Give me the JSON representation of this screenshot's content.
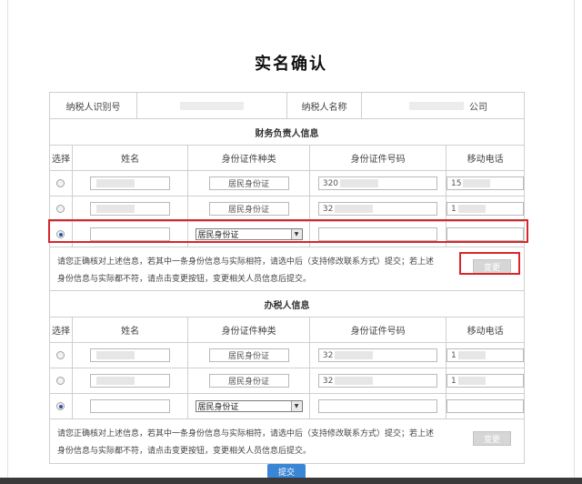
{
  "title": "实名确认",
  "taxpayer": {
    "id_label": "纳税人识别号",
    "name_label": "纳税人名称",
    "name_suffix": "公司"
  },
  "finance_section": {
    "title": "财务负责人信息",
    "headers": [
      "选择",
      "姓名",
      "身份证件种类",
      "身份证件号码",
      "移动电话"
    ],
    "rows": [
      {
        "selected": false,
        "name": "",
        "id_type": "居民身份证",
        "id_no": "320",
        "phone": "15"
      },
      {
        "selected": false,
        "name": "",
        "id_type": "居民身份证",
        "id_no": "32",
        "phone": "1"
      },
      {
        "selected": true,
        "name": "",
        "id_type": "居民身份证",
        "id_no": "",
        "phone": ""
      }
    ],
    "note": "请您正确核对上述信息，若其中一条身份信息与实际相符，请选中后（支持修改联系方式）提交；若上述身份信息与实际都不符，请点击变更按钮，变更相关人员信息后提交。",
    "change_label": "变更"
  },
  "agent_section": {
    "title": "办税人信息",
    "headers": [
      "选择",
      "姓名",
      "身份证件种类",
      "身份证件号码",
      "移动电话"
    ],
    "rows": [
      {
        "selected": false,
        "name": "",
        "id_type": "居民身份证",
        "id_no": "32",
        "phone": "1"
      },
      {
        "selected": false,
        "name": "",
        "id_type": "居民身份证",
        "id_no": "32",
        "phone": "1"
      },
      {
        "selected": true,
        "name": "",
        "id_type": "居民身份证",
        "id_no": "",
        "phone": ""
      }
    ],
    "note": "请您正确核对上述信息，若其中一条身份信息与实际相符，请选中后（支持修改联系方式）提交；若上述身份信息与实际都不符，请点击变更按钮，变更相关人员信息后提交。",
    "change_label": "变更"
  },
  "submit_label": "提交",
  "colors": {
    "highlight": "#d9262b",
    "submit": "#3a86d6",
    "radio_selected": "#2557a7"
  }
}
